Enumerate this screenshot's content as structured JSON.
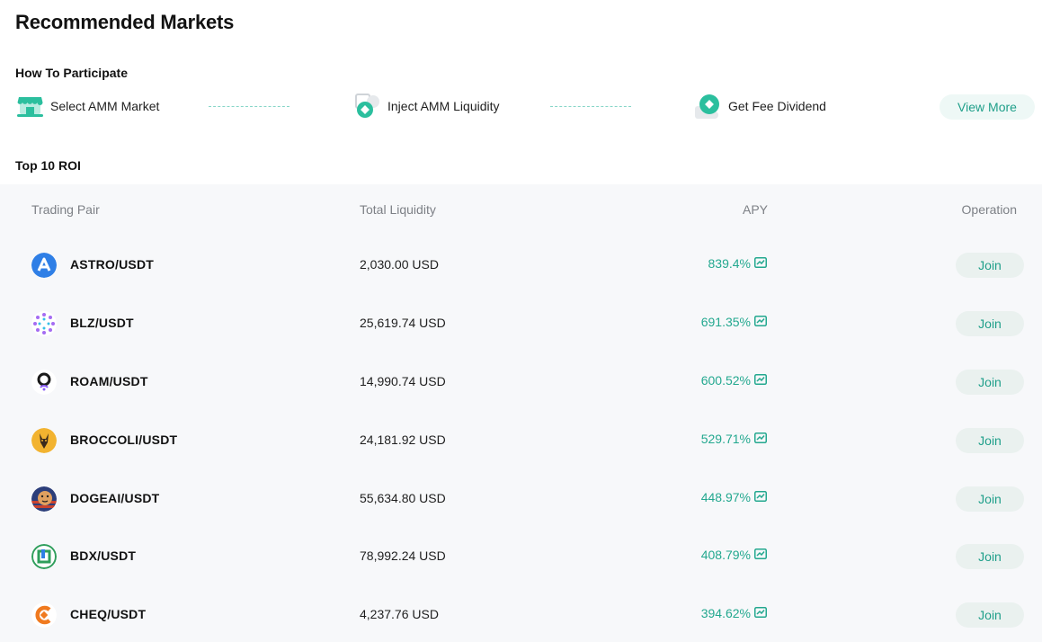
{
  "page_title": "Recommended Markets",
  "how_to": {
    "label": "How To Participate",
    "steps": [
      {
        "label": "Select AMM Market",
        "icon": "market-stall-icon"
      },
      {
        "label": "Inject AMM Liquidity",
        "icon": "liquidity-inject-icon"
      },
      {
        "label": "Get Fee Dividend",
        "icon": "fee-dividend-icon"
      }
    ],
    "view_more": "View More"
  },
  "top_roi": {
    "label": "Top 10 ROI",
    "columns": {
      "pair": "Trading Pair",
      "liquidity": "Total Liquidity",
      "apy": "APY",
      "operation": "Operation"
    },
    "rows": [
      {
        "pair": "ASTRO/USDT",
        "liquidity": "2,030.00 USD",
        "apy": "839.4%",
        "action": "Join",
        "icon": "astro-coin-icon",
        "color": "#2f7fe6"
      },
      {
        "pair": "BLZ/USDT",
        "liquidity": "25,619.74 USD",
        "apy": "691.35%",
        "action": "Join",
        "icon": "blz-coin-icon",
        "color": "#a56cf2"
      },
      {
        "pair": "ROAM/USDT",
        "liquidity": "14,990.74 USD",
        "apy": "600.52%",
        "action": "Join",
        "icon": "roam-coin-icon",
        "color": "#1a1a1a"
      },
      {
        "pair": "BROCCOLI/USDT",
        "liquidity": "24,181.92 USD",
        "apy": "529.71%",
        "action": "Join",
        "icon": "broccoli-coin-icon",
        "color": "#f2b330"
      },
      {
        "pair": "DOGEAI/USDT",
        "liquidity": "55,634.80 USD",
        "apy": "448.97%",
        "action": "Join",
        "icon": "dogeai-coin-icon",
        "color": "#c8432f"
      },
      {
        "pair": "BDX/USDT",
        "liquidity": "78,992.24 USD",
        "apy": "408.79%",
        "action": "Join",
        "icon": "bdx-coin-icon",
        "color": "#2e9e5b"
      },
      {
        "pair": "CHEQ/USDT",
        "liquidity": "4,237.76 USD",
        "apy": "394.62%",
        "action": "Join",
        "icon": "cheq-coin-icon",
        "color": "#f07a1f"
      }
    ]
  },
  "colors": {
    "accent": "#23a88f",
    "button_bg": "#eaf1ef",
    "table_bg": "#f7f8fa"
  }
}
